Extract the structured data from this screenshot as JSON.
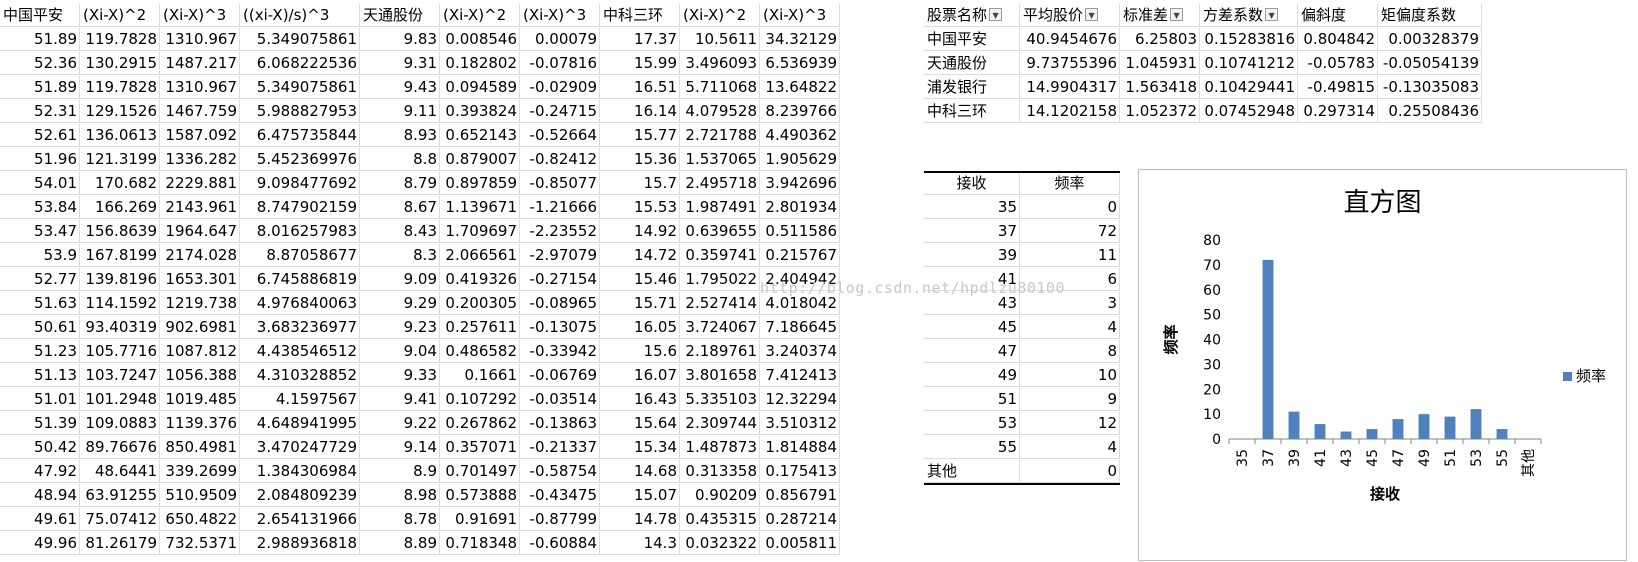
{
  "left_table": {
    "headers": [
      "中国平安",
      "(Xi-X)^2",
      "(Xi-X)^3",
      "((xi-X)/s)^3",
      "天通股份",
      "(Xi-X)^2",
      "(Xi-X)^3",
      "中科三环",
      "(Xi-X)^2",
      "(Xi-X)^3"
    ],
    "rows": [
      [
        "51.89",
        "119.7828",
        "1310.967",
        "5.349075861",
        "9.83",
        "0.008546",
        "0.00079",
        "17.37",
        "10.5611",
        "34.32129"
      ],
      [
        "52.36",
        "130.2915",
        "1487.217",
        "6.068222536",
        "9.31",
        "0.182802",
        "-0.07816",
        "15.99",
        "3.496093",
        "6.536939"
      ],
      [
        "51.89",
        "119.7828",
        "1310.967",
        "5.349075861",
        "9.43",
        "0.094589",
        "-0.02909",
        "16.51",
        "5.711068",
        "13.64822"
      ],
      [
        "52.31",
        "129.1526",
        "1467.759",
        "5.988827953",
        "9.11",
        "0.393824",
        "-0.24715",
        "16.14",
        "4.079528",
        "8.239766"
      ],
      [
        "52.61",
        "136.0613",
        "1587.092",
        "6.475735844",
        "8.93",
        "0.652143",
        "-0.52664",
        "15.77",
        "2.721788",
        "4.490362"
      ],
      [
        "51.96",
        "121.3199",
        "1336.282",
        "5.452369976",
        "8.8",
        "0.879007",
        "-0.82412",
        "15.36",
        "1.537065",
        "1.905629"
      ],
      [
        "54.01",
        "170.682",
        "2229.881",
        "9.098477692",
        "8.79",
        "0.897859",
        "-0.85077",
        "15.7",
        "2.495718",
        "3.942696"
      ],
      [
        "53.84",
        "166.269",
        "2143.961",
        "8.747902159",
        "8.67",
        "1.139671",
        "-1.21666",
        "15.53",
        "1.987491",
        "2.801934"
      ],
      [
        "53.47",
        "156.8639",
        "1964.647",
        "8.016257983",
        "8.43",
        "1.709697",
        "-2.23552",
        "14.92",
        "0.639655",
        "0.511586"
      ],
      [
        "53.9",
        "167.8199",
        "2174.028",
        "8.87058677",
        "8.3",
        "2.066561",
        "-2.97079",
        "14.72",
        "0.359741",
        "0.215767"
      ],
      [
        "52.77",
        "139.8196",
        "1653.301",
        "6.745886819",
        "9.09",
        "0.419326",
        "-0.27154",
        "15.46",
        "1.795022",
        "2.404942"
      ],
      [
        "51.63",
        "114.1592",
        "1219.738",
        "4.976840063",
        "9.29",
        "0.200305",
        "-0.08965",
        "15.71",
        "2.527414",
        "4.018042"
      ],
      [
        "50.61",
        "93.40319",
        "902.6981",
        "3.683236977",
        "9.23",
        "0.257611",
        "-0.13075",
        "16.05",
        "3.724067",
        "7.186645"
      ],
      [
        "51.23",
        "105.7716",
        "1087.812",
        "4.438546512",
        "9.04",
        "0.486582",
        "-0.33942",
        "15.6",
        "2.189761",
        "3.240374"
      ],
      [
        "51.13",
        "103.7247",
        "1056.388",
        "4.310328852",
        "9.33",
        "0.1661",
        "-0.06769",
        "16.07",
        "3.801658",
        "7.412413"
      ],
      [
        "51.01",
        "101.2948",
        "1019.485",
        "4.1597567",
        "9.41",
        "0.107292",
        "-0.03514",
        "16.43",
        "5.335103",
        "12.32294"
      ],
      [
        "51.39",
        "109.0883",
        "1139.376",
        "4.648941995",
        "9.22",
        "0.267862",
        "-0.13863",
        "15.64",
        "2.309744",
        "3.510312"
      ],
      [
        "50.42",
        "89.76676",
        "850.4981",
        "3.470247729",
        "9.14",
        "0.357071",
        "-0.21337",
        "15.34",
        "1.487873",
        "1.814884"
      ],
      [
        "47.92",
        "48.6441",
        "339.2699",
        "1.384306984",
        "8.9",
        "0.701497",
        "-0.58754",
        "14.68",
        "0.313358",
        "0.175413"
      ],
      [
        "48.94",
        "63.91255",
        "510.9509",
        "2.084809239",
        "8.98",
        "0.573888",
        "-0.43475",
        "15.07",
        "0.90209",
        "0.856791"
      ],
      [
        "49.61",
        "75.07412",
        "650.4822",
        "2.654131966",
        "8.78",
        "0.91691",
        "-0.87799",
        "14.78",
        "0.435315",
        "0.287214"
      ],
      [
        "49.96",
        "81.26179",
        "732.5371",
        "2.988936818",
        "8.89",
        "0.718348",
        "-0.60884",
        "14.3",
        "0.032322",
        "0.005811"
      ]
    ]
  },
  "stats_table": {
    "headers": [
      "股票名称",
      "平均股价",
      "标准差",
      "方差系数",
      "偏斜度",
      "矩偏度系数"
    ],
    "rows": [
      [
        "中国平安",
        "40.9454676",
        "6.25803",
        "0.15283816",
        "0.804842",
        "0.00328379"
      ],
      [
        "天通股份",
        "9.73755396",
        "1.045931",
        "0.10741212",
        "-0.05783",
        "-0.05054139"
      ],
      [
        "浦发银行",
        "14.9904317",
        "1.563418",
        "0.10429441",
        "-0.49815",
        "-0.13035083"
      ],
      [
        "中科三环",
        "14.1202158",
        "1.052372",
        "0.07452948",
        "0.297314",
        "0.25508436"
      ]
    ]
  },
  "bin_table": {
    "headers": [
      "接收",
      "频率"
    ],
    "rows": [
      [
        "35",
        "0"
      ],
      [
        "37",
        "72"
      ],
      [
        "39",
        "11"
      ],
      [
        "41",
        "6"
      ],
      [
        "43",
        "3"
      ],
      [
        "45",
        "4"
      ],
      [
        "47",
        "8"
      ],
      [
        "49",
        "10"
      ],
      [
        "51",
        "9"
      ],
      [
        "53",
        "12"
      ],
      [
        "55",
        "4"
      ],
      [
        "其他",
        "0"
      ]
    ]
  },
  "watermark": "http://blog.csdn.net/hpdlzu80100",
  "chart_data": {
    "type": "bar",
    "title": "直方图",
    "xlabel": "接收",
    "ylabel": "频率",
    "categories": [
      "35",
      "37",
      "39",
      "41",
      "43",
      "45",
      "47",
      "49",
      "51",
      "53",
      "55",
      "其他"
    ],
    "series": [
      {
        "name": "频率",
        "values": [
          0,
          72,
          11,
          6,
          3,
          4,
          8,
          10,
          9,
          12,
          4,
          0
        ],
        "color": "#4f81bd"
      }
    ],
    "ylim": [
      0,
      80
    ],
    "yticks": [
      "0",
      "10",
      "20",
      "30",
      "40",
      "50",
      "60",
      "70",
      "80"
    ],
    "legend": "right",
    "grid": false
  }
}
